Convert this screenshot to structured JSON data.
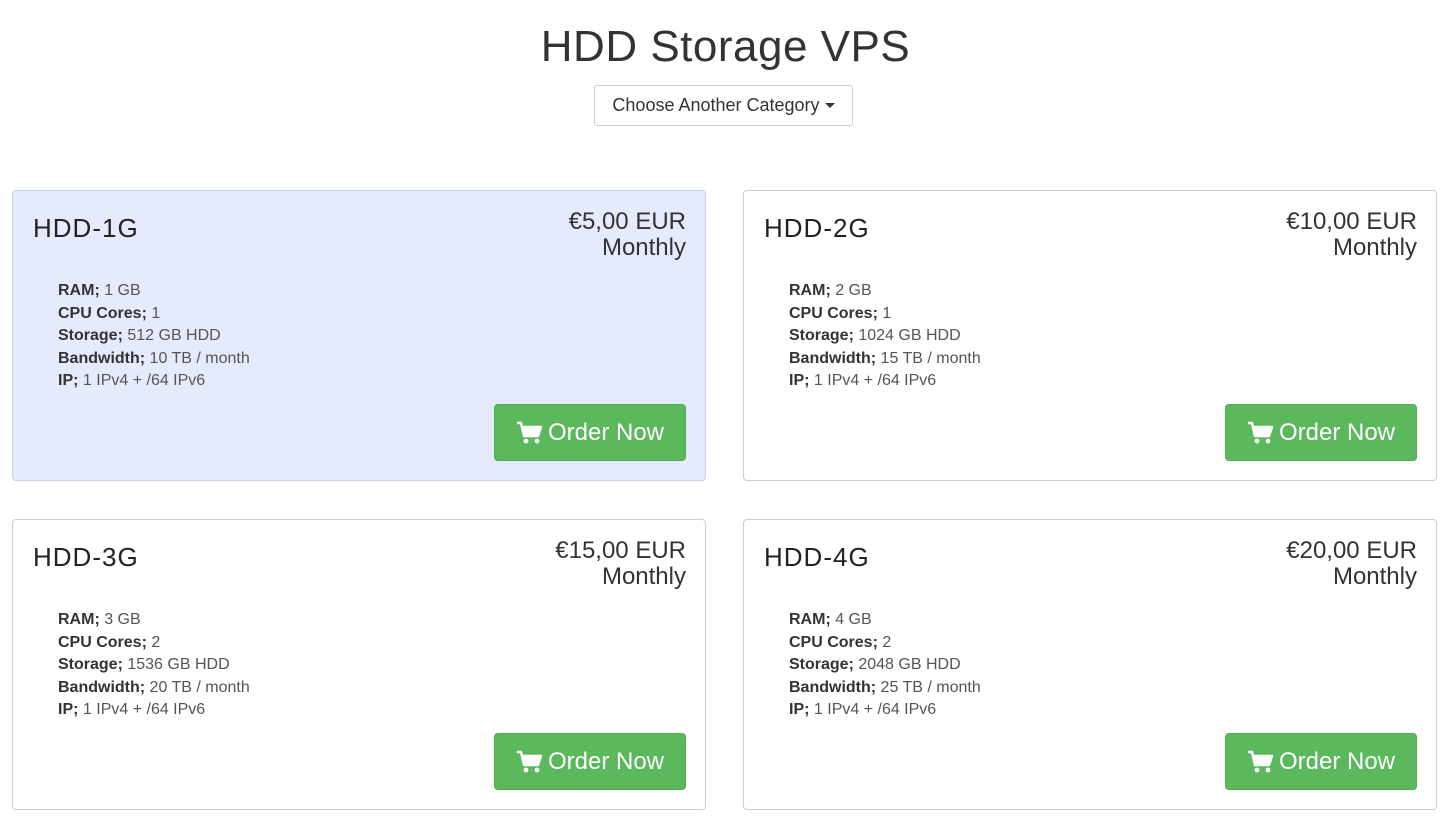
{
  "header": {
    "title": "HDD Storage VPS",
    "category_button_label": "Choose Another Category"
  },
  "plans": [
    {
      "name": "HDD-1G",
      "price": "€5,00 EUR",
      "period": "Monthly",
      "highlighted": true,
      "features": [
        {
          "label": "RAM;",
          "value": " 1 GB"
        },
        {
          "label": "CPU Cores;",
          "value": " 1"
        },
        {
          "label": "Storage;",
          "value": " 512 GB HDD"
        },
        {
          "label": "Bandwidth;",
          "value": " 10 TB / month"
        },
        {
          "label": "IP;",
          "value": " 1 IPv4 + /64 IPv6"
        }
      ],
      "button_label": "Order Now"
    },
    {
      "name": "HDD-2G",
      "price": "€10,00 EUR",
      "period": "Monthly",
      "highlighted": false,
      "features": [
        {
          "label": "RAM;",
          "value": " 2 GB"
        },
        {
          "label": "CPU Cores;",
          "value": " 1"
        },
        {
          "label": "Storage;",
          "value": " 1024 GB HDD"
        },
        {
          "label": "Bandwidth;",
          "value": " 15 TB / month"
        },
        {
          "label": "IP;",
          "value": " 1 IPv4 + /64 IPv6"
        }
      ],
      "button_label": "Order Now"
    },
    {
      "name": "HDD-3G",
      "price": "€15,00 EUR",
      "period": "Monthly",
      "highlighted": false,
      "features": [
        {
          "label": "RAM;",
          "value": " 3 GB"
        },
        {
          "label": "CPU Cores;",
          "value": " 2"
        },
        {
          "label": "Storage;",
          "value": " 1536 GB HDD"
        },
        {
          "label": "Bandwidth;",
          "value": " 20 TB / month"
        },
        {
          "label": "IP;",
          "value": " 1 IPv4 + /64 IPv6"
        }
      ],
      "button_label": "Order Now"
    },
    {
      "name": "HDD-4G",
      "price": "€20,00 EUR",
      "period": "Monthly",
      "highlighted": false,
      "features": [
        {
          "label": "RAM;",
          "value": " 4 GB"
        },
        {
          "label": "CPU Cores;",
          "value": " 2"
        },
        {
          "label": "Storage;",
          "value": " 2048 GB HDD"
        },
        {
          "label": "Bandwidth;",
          "value": " 25 TB / month"
        },
        {
          "label": "IP;",
          "value": " 1 IPv4 + /64 IPv6"
        }
      ],
      "button_label": "Order Now"
    }
  ],
  "icons": {
    "dropdown": "caret-down-icon",
    "order": "shopping-cart-icon"
  },
  "colors": {
    "order_button": "#5cb85c",
    "highlighted_card": "#e5ebfd"
  }
}
